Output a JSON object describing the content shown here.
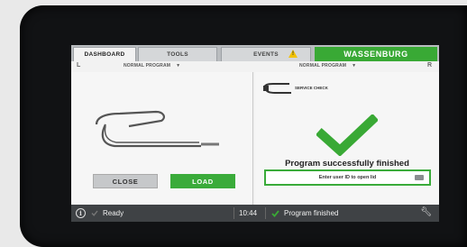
{
  "tabs": [
    {
      "label": "DASHBOARD",
      "active": true
    },
    {
      "label": "TOOLS",
      "active": false
    },
    {
      "label": "EVENTS",
      "active": false
    }
  ],
  "events_warning_icon": "warning-triangle-icon",
  "brand": "WASSENBURG",
  "left_panel": {
    "side": "L",
    "program": "NORMAL PROGRAM",
    "close_button": "CLOSE",
    "load_button": "LOAD"
  },
  "right_panel": {
    "side": "R",
    "program": "NORMAL PROGRAM",
    "service_check": "SERVICE CHECK",
    "status_message": "Program successfully finished",
    "userid_prompt": "Enter user ID to open lid"
  },
  "statusbar": {
    "left_status": "Ready",
    "time": "10:44",
    "right_status": "Program finished"
  },
  "colors": {
    "accent_green": "#39a935",
    "statusbar_bg": "#3f4245",
    "warning_yellow": "#f2c200"
  }
}
